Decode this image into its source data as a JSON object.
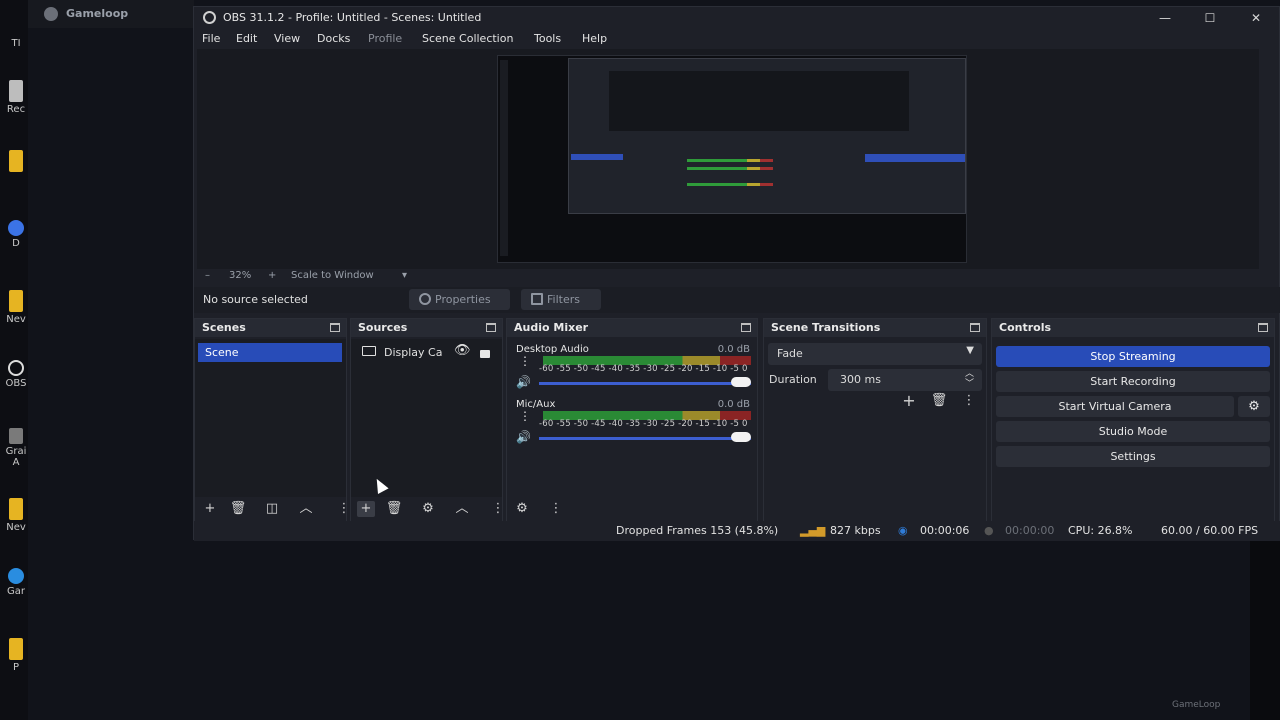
{
  "desktop": {
    "bg_app_title": "Gameloop",
    "icons": [
      {
        "label": "TI",
        "color": "#cfcfcf"
      },
      {
        "label": "Rec",
        "color": "#bdbdbd"
      },
      {
        "label": "",
        "color": "#e6b422"
      },
      {
        "label": "D",
        "color": "#3b73e6"
      },
      {
        "label": "Nev",
        "color": "#e6b422"
      },
      {
        "label": "OBS",
        "color": "#dcdcdc"
      },
      {
        "label": "Grai A",
        "color": "#cccccc"
      },
      {
        "label": "Nev",
        "color": "#e6b422"
      },
      {
        "label": "Gar",
        "color": "#2a8de0"
      },
      {
        "label": "P",
        "color": "#e6b422"
      }
    ],
    "watermark": "GameLoop"
  },
  "window": {
    "title": "OBS 31.1.2 - Profile: Untitled - Scenes: Untitled",
    "minimize": "—",
    "maximize": "☐",
    "close": "✕"
  },
  "menu": {
    "items": [
      "File",
      "Edit",
      "View",
      "Docks",
      "Profile",
      "Scene Collection",
      "Tools",
      "Help"
    ]
  },
  "zoom": {
    "minus": "–",
    "value": "32%",
    "plus": "+",
    "mode": "Scale to Window",
    "arrow": "▾"
  },
  "source_bar": {
    "status": "No source selected",
    "properties": "Properties",
    "filters": "Filters"
  },
  "scenes": {
    "title": "Scenes",
    "items": [
      "Scene"
    ]
  },
  "sources": {
    "title": "Sources",
    "items": [
      {
        "label": "Display Ca"
      }
    ]
  },
  "mixer": {
    "title": "Audio Mixer",
    "scale": "-60 -55 -50 -45 -40 -35 -30 -25 -20 -15 -10 -5 0",
    "channels": [
      {
        "name": "Desktop Audio",
        "db": "0.0 dB",
        "volume": 1.0
      },
      {
        "name": "Mic/Aux",
        "db": "0.0 dB",
        "volume": 1.0
      }
    ]
  },
  "transitions": {
    "title": "Scene Transitions",
    "selected": "Fade",
    "duration_label": "Duration",
    "duration_value": "300 ms"
  },
  "controls": {
    "title": "Controls",
    "stop_streaming": "Stop Streaming",
    "start_recording": "Start Recording",
    "start_virtual_camera": "Start Virtual Camera",
    "studio_mode": "Studio Mode",
    "settings": "Settings"
  },
  "status": {
    "dropped": "Dropped Frames 153 (45.8%)",
    "bitrate": "827 kbps",
    "stream_time": "00:00:06",
    "rec_time": "00:00:00",
    "cpu": "CPU: 26.8%",
    "fps": "60.00 / 60.00 FPS"
  },
  "colors": {
    "accent": "#284cb8",
    "live": "#2f7bd6"
  }
}
